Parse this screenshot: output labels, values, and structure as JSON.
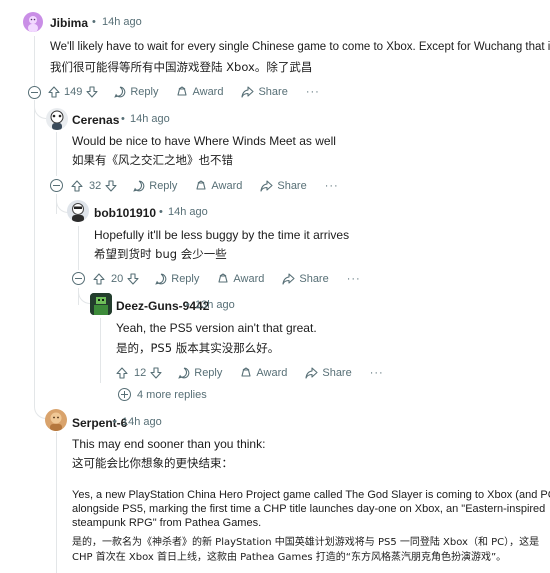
{
  "separator": "•",
  "more_label": "···",
  "comments": {
    "c1": {
      "author": "Jibima",
      "time": "14h ago",
      "text_en": "We'll likely have to wait for every single Chinese game to come to Xbox. Except for Wuchang that is",
      "text_zh": "我们很可能得等所有中国游戏登陆 Xbox。除了武昌",
      "votes": "149",
      "reply": "Reply",
      "award": "Award",
      "share": "Share"
    },
    "c2": {
      "author": "Cerenas",
      "time": "14h ago",
      "text_en": "Would be nice to have Where Winds Meet as well",
      "text_zh": "如果有《风之交汇之地》也不错",
      "votes": "32",
      "reply": "Reply",
      "award": "Award",
      "share": "Share"
    },
    "c3": {
      "author": "bob101910",
      "time": "14h ago",
      "text_en": "Hopefully it'll be less buggy by the time it arrives",
      "text_zh": "希望到货时 bug 会少一些",
      "votes": "20",
      "reply": "Reply",
      "award": "Award",
      "share": "Share"
    },
    "c4": {
      "author": "Deez-Guns-9442",
      "time": "13h ago",
      "text_en": "Yeah, the PS5 version ain't that great.",
      "text_zh": "是的，PS5 版本其实没那么好。",
      "votes": "12",
      "reply": "Reply",
      "award": "Award",
      "share": "Share",
      "more_replies": "4 more replies"
    },
    "c5": {
      "author": "Serpent-6",
      "time": "14h ago",
      "text_en_1": "This may end sooner than you think:",
      "text_zh_1": "这可能会比你想象的更快结束：",
      "para_en_1": "Yes, a new PlayStation China Hero Project game called The God Slayer is coming to Xbox (and PC)",
      "para_en_2": "alongside PS5, marking the first time a CHP title launches day-one on Xbox, an \"Eastern-inspired",
      "para_en_3": "steampunk RPG\" from Pathea Games.",
      "para_zh_1": "是的，一款名为《神杀者》的新 PlayStation 中国英雄计划游戏将与 PS5 一同登陆 Xbox（和 PC），这是",
      "para_zh_2": "CHP 首次在 Xbox 首日上线，这款由 Pathea Games 打造的“东方风格蒸汽朋克角色扮演游戏”。"
    }
  },
  "colors": {
    "thread_line": "#e3e6e8",
    "meta_text": "#576f76",
    "body_text": "#1c1c1c",
    "avatar_jibima": "#c98ee6",
    "avatar_serpent": "#d9a36c"
  }
}
